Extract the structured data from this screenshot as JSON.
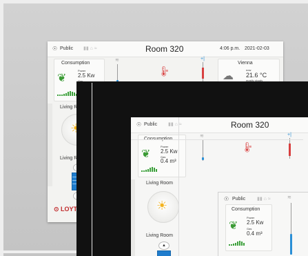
{
  "header": {
    "access": "Public",
    "room": "Room 320",
    "time": "4:06 p.m.",
    "date": "2021-02-03"
  },
  "consumption": {
    "title": "Consumption",
    "power_label": "Power",
    "power_value": "2.5 Kw",
    "gas_label": "Gas",
    "gas_value": "0.4 m³"
  },
  "weather": {
    "city": "Vienna",
    "now_label": "now",
    "temperature": "21.6 °C",
    "condition": "mostly cloudy"
  },
  "zones": {
    "light_zone": "Living Room",
    "blind_zone": "Living Room"
  },
  "brand": {
    "logo": "LOYTEC"
  },
  "icons": {
    "access": "user-icon",
    "plant": "plant-icon",
    "bulb": "light-bulb-icon",
    "cloud": "cloud-icon",
    "thermo": "thermometer-icon",
    "up": "up-arrow-icon",
    "down": "down-arrow-icon"
  },
  "colors": {
    "accent_blue": "#2a8fd6",
    "alert_red": "#d84040",
    "eco_green": "#3b9b35",
    "bulb_yellow": "#f3b31f"
  }
}
